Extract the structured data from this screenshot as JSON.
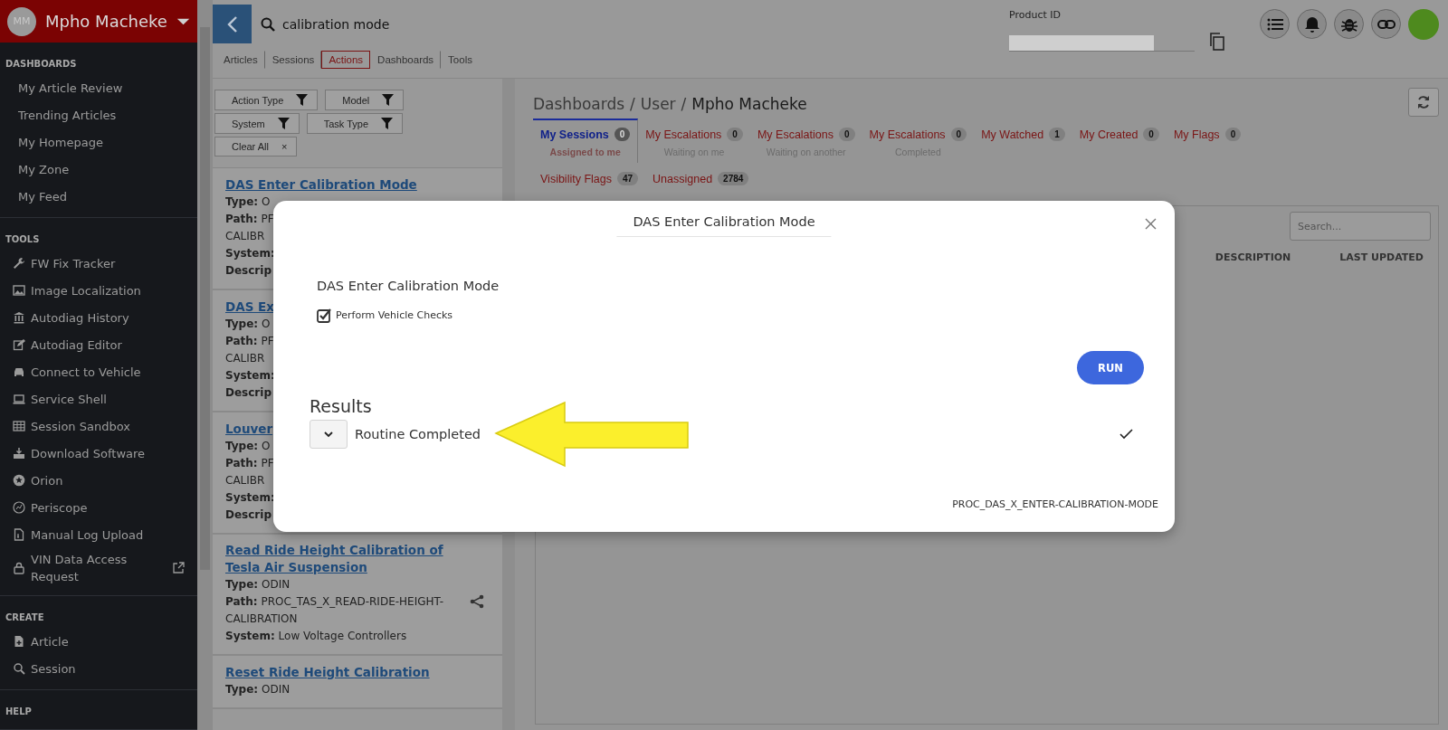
{
  "sidebar": {
    "user": {
      "initials": "MM",
      "name": "Mpho Macheke"
    },
    "sections": [
      {
        "title": "DASHBOARDS",
        "items": [
          {
            "label": "My Article Review",
            "external": false
          },
          {
            "label": "Trending Articles",
            "external": false
          },
          {
            "label": "My Homepage",
            "external": false
          },
          {
            "label": "My Zone",
            "external": false
          },
          {
            "label": "My Feed",
            "external": false
          }
        ]
      },
      {
        "title": "TOOLS",
        "items": [
          {
            "label": "FW Fix Tracker",
            "external": false
          },
          {
            "label": "Image Localization",
            "external": false
          },
          {
            "label": "Autodiag History",
            "external": false
          },
          {
            "label": "Autodiag Editor",
            "external": false
          },
          {
            "label": "Connect to Vehicle",
            "external": false
          },
          {
            "label": "Service Shell",
            "external": false
          },
          {
            "label": "Session Sandbox",
            "external": false
          },
          {
            "label": "Download Software",
            "external": false
          },
          {
            "label": "Orion",
            "external": false
          },
          {
            "label": "Periscope",
            "external": false
          },
          {
            "label": "Manual Log Upload",
            "external": false
          },
          {
            "label": "VIN Data Access Request",
            "external": true
          }
        ]
      },
      {
        "title": "CREATE",
        "items": [
          {
            "label": "Article",
            "external": false
          },
          {
            "label": "Session",
            "external": false
          }
        ]
      },
      {
        "title": "HELP"
      }
    ]
  },
  "search": {
    "value": "calibration mode"
  },
  "search_tabs": [
    {
      "label": "Articles",
      "selected": false
    },
    {
      "label": "Sessions",
      "selected": false
    },
    {
      "label": "Actions",
      "selected": true
    },
    {
      "label": "Dashboards",
      "selected": false
    },
    {
      "label": "Tools",
      "selected": false
    }
  ],
  "filters": [
    {
      "label": "Action Type"
    },
    {
      "label": "Model"
    },
    {
      "label": "System"
    },
    {
      "label": "Task Type"
    }
  ],
  "clear_all": {
    "label": "Clear All",
    "close": "×"
  },
  "results_list": [
    {
      "title": "DAS Enter Calibration Mode",
      "lines": [
        "**Type:** O",
        "**Path:** PF",
        "CALIBR",
        "**System:**",
        "**Descrip**"
      ]
    },
    {
      "title": "DAS Ex",
      "lines": [
        "**Type:** O",
        "**Path:** PF",
        "CALIBR",
        "**System:**",
        "**Descrip**"
      ]
    },
    {
      "title": "Louver",
      "lines": [
        "**Type:** O",
        "**Path:** PF",
        "CALIBR",
        "**System:**",
        "**Descrip**"
      ]
    },
    {
      "title": "Read Ride Height Calibration of Tesla Air Suspension",
      "share": true,
      "lines": [
        "**Type:** ODIN",
        "**Path:** PROC_TAS_X_READ-RIDE-HEIGHT-CALIBRATION",
        "**System:** Low Voltage Controllers"
      ]
    },
    {
      "title": "Reset Ride Height Calibration",
      "share": false,
      "lines": [
        "**Type:** ODIN"
      ]
    }
  ],
  "product_id": {
    "label": "Product ID"
  },
  "breadcrumb_separator": "/",
  "breadcrumb": [
    {
      "label": "Dashboards",
      "current": false
    },
    {
      "label": "User",
      "current": false
    },
    {
      "label": "Mpho Macheke",
      "current": true
    }
  ],
  "dashboard_tabs": [
    {
      "label": "My Sessions",
      "count": "0",
      "sublabel": "Assigned to me",
      "selected": true
    },
    {
      "label": "My Escalations",
      "count": "0",
      "sublabel": "Waiting on me",
      "selected": false
    },
    {
      "label": "My Escalations",
      "count": "0",
      "sublabel": "Waiting on another",
      "selected": false
    },
    {
      "label": "My Escalations",
      "count": "0",
      "sublabel": "Completed",
      "selected": false
    },
    {
      "label": "My Watched",
      "count": "1",
      "selected": false
    },
    {
      "label": "My Created",
      "count": "0",
      "selected": false
    },
    {
      "label": "My Flags",
      "count": "0",
      "selected": false
    }
  ],
  "dashboard_tabs_row2": [
    {
      "label": "Visibility Flags",
      "count": "47",
      "selected": false
    },
    {
      "label": "Unassigned",
      "count": "2784",
      "selected": false
    }
  ],
  "table": {
    "search": {
      "placeholder": "Search..."
    },
    "columns": [
      "DESCRIPTION",
      "LAST UPDATED"
    ]
  },
  "modal": {
    "title": "DAS Enter Calibration Mode",
    "heading": "DAS Enter Calibration Mode",
    "checkbox": {
      "label": "Perform Vehicle Checks",
      "checked": true
    },
    "run_button": "RUN",
    "results_title": "Results",
    "results": [
      {
        "label": "Routine Completed",
        "expanded": false,
        "success": true
      }
    ],
    "code": "PROC_DAS_X_ENTER-CALIBRATION-MODE"
  }
}
